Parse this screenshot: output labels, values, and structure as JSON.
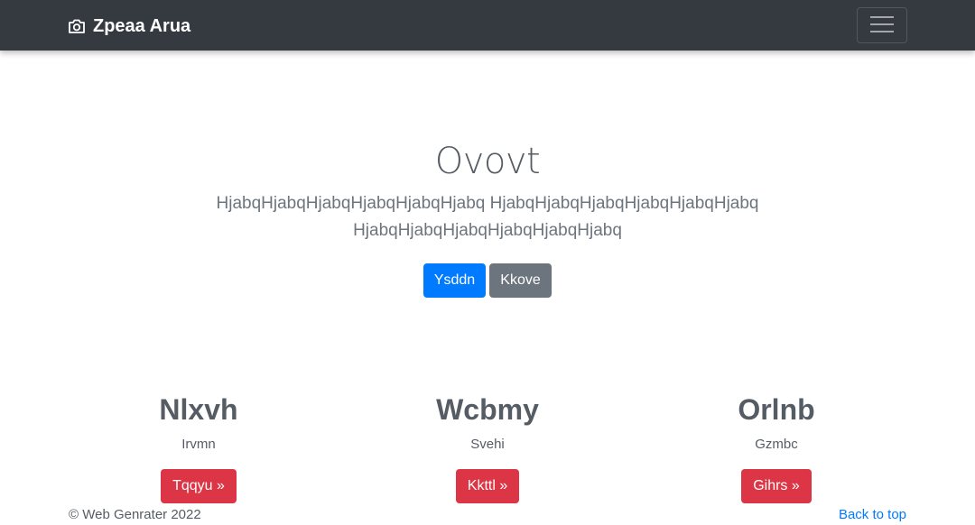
{
  "navbar": {
    "brand_icon": "camera-icon",
    "brand_label": "Zpeaa Arua",
    "toggler_icon": "hamburger-menu-icon",
    "background": "#343a40"
  },
  "hero": {
    "title": "Ovovt",
    "lead": "HjabqHjabqHjabqHjabqHjabqHjabq HjabqHjabqHjabqHjabqHjabqHjabq HjabqHjabqHjabqHjabqHjabqHjabq",
    "primary_button": "Ysddn",
    "secondary_button": "Kkove"
  },
  "columns": [
    {
      "heading": "Nlxvh",
      "text": "Irvmn",
      "button": "Tqqyu »"
    },
    {
      "heading": "Wcbmy",
      "text": "Svehi",
      "button": "Kkttl »"
    },
    {
      "heading": "Orlnb",
      "text": "Gzmbc",
      "button": "Gihrs »"
    }
  ],
  "footer": {
    "copyright": "© Web Genrater 2022",
    "back_to_top": "Back to top"
  },
  "colors": {
    "primary": "#007bff",
    "secondary": "#6c757d",
    "danger": "#dc3545",
    "dark": "#343a40"
  }
}
